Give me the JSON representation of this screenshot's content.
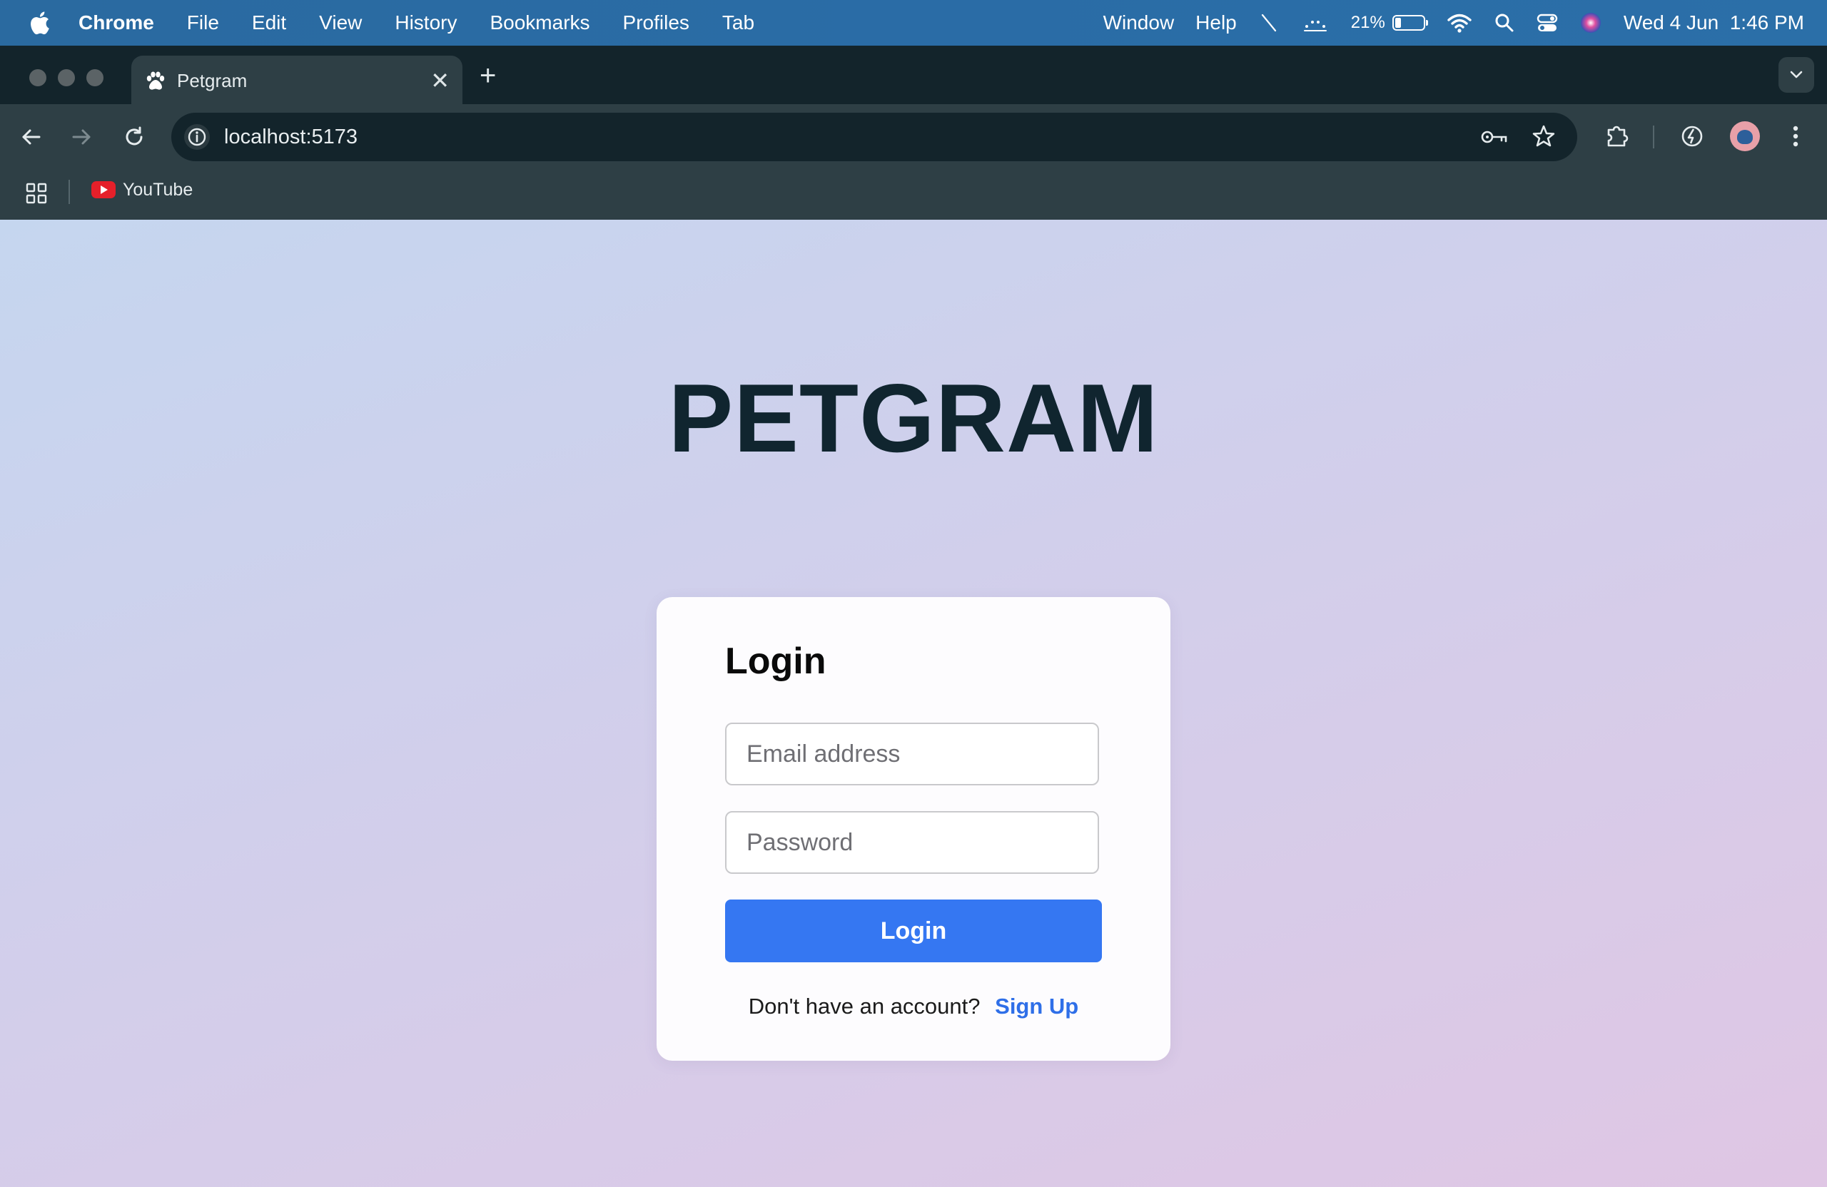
{
  "menubar": {
    "app": "Chrome",
    "menus": [
      "File",
      "Edit",
      "View",
      "History",
      "Bookmarks",
      "Profiles",
      "Tab"
    ],
    "window": "Window",
    "help": "Help",
    "battery_percent": "21%",
    "battery_level": 0.21,
    "datetime": "Wed 4 Jun  1:46 PM"
  },
  "browser": {
    "tab_title": "Petgram",
    "new_tab": "+",
    "url": "localhost:5173",
    "bookmarks": [
      {
        "label": "YouTube",
        "icon": "youtube-icon"
      }
    ]
  },
  "page": {
    "brand": "PETGRAM",
    "login_card": {
      "heading": "Login",
      "email_placeholder": "Email address",
      "password_placeholder": "Password",
      "submit_label": "Login",
      "signup_prompt": "Don't have an account?",
      "signup_link": "Sign Up"
    }
  },
  "colors": {
    "primary_button": "#3577f2",
    "link": "#2f6fe8",
    "brand_text": "#10252f"
  }
}
